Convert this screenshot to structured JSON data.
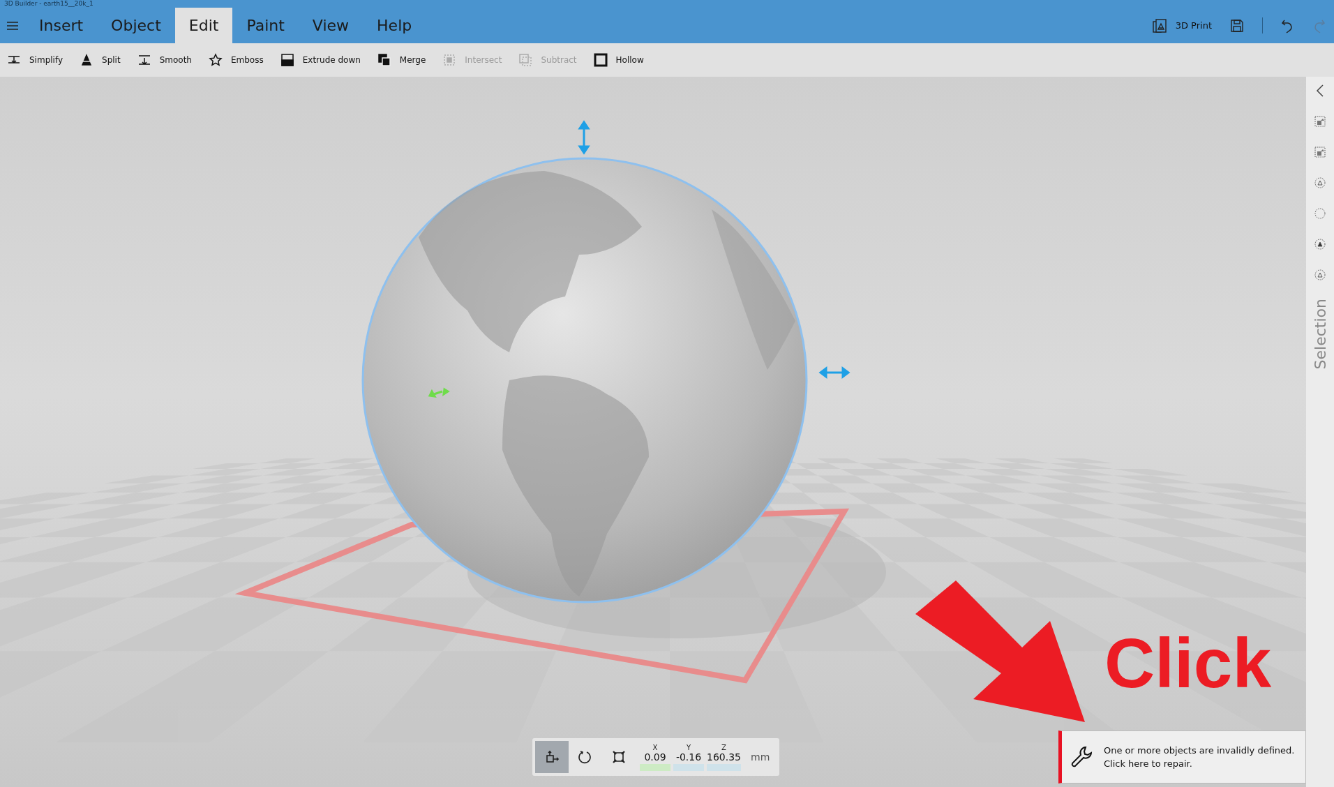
{
  "window": {
    "title": "3D Builder - earth15__20k_1"
  },
  "menu_tabs": [
    {
      "label": "Insert",
      "selected": false
    },
    {
      "label": "Object",
      "selected": false
    },
    {
      "label": "Edit",
      "selected": true
    },
    {
      "label": "Paint",
      "selected": false
    },
    {
      "label": "View",
      "selected": false
    },
    {
      "label": "Help",
      "selected": false
    }
  ],
  "top_actions": {
    "print_label": "3D Print"
  },
  "toolbar": [
    {
      "kind": "simplify",
      "label": "Simplify",
      "disabled": false
    },
    {
      "kind": "split",
      "label": "Split",
      "disabled": false
    },
    {
      "kind": "smooth",
      "label": "Smooth",
      "disabled": false
    },
    {
      "kind": "emboss",
      "label": "Emboss",
      "disabled": false
    },
    {
      "kind": "extrude",
      "label": "Extrude down",
      "disabled": false
    },
    {
      "kind": "merge",
      "label": "Merge",
      "disabled": false
    },
    {
      "kind": "intersect",
      "label": "Intersect",
      "disabled": true
    },
    {
      "kind": "subtract",
      "label": "Subtract",
      "disabled": true
    },
    {
      "kind": "hollow",
      "label": "Hollow",
      "disabled": false
    }
  ],
  "side_panel": {
    "label": "Selection"
  },
  "annotation": {
    "text": "Click"
  },
  "transform_panel": {
    "tools": [
      {
        "kind": "move",
        "selected": true
      },
      {
        "kind": "rotate",
        "selected": false
      },
      {
        "kind": "scale",
        "selected": false
      }
    ],
    "axes": [
      {
        "label": "X",
        "value": "0.09",
        "color": "#cdebc4"
      },
      {
        "label": "Y",
        "value": "-0.16",
        "color": "#cfe2ea"
      },
      {
        "label": "Z",
        "value": "160.35",
        "color": "#cfe2ea"
      }
    ],
    "unit": "mm"
  },
  "notification": {
    "message": "One or more objects are invalidly defined.",
    "action": "Click here to repair."
  }
}
